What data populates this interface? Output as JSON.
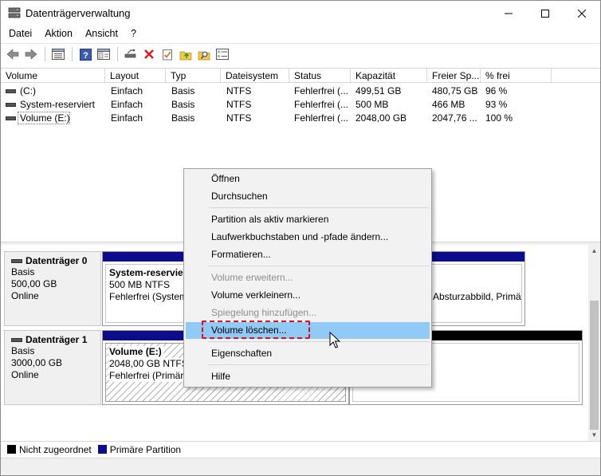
{
  "window": {
    "title": "Datenträgerverwaltung",
    "controls": {
      "minimize": "minimize",
      "maximize": "maximize",
      "close": "close"
    }
  },
  "menubar": [
    "Datei",
    "Aktion",
    "Ansicht",
    "?"
  ],
  "toolbar": [
    "back-arrow-icon",
    "forward-arrow-icon",
    "properties-list-icon",
    "help-icon",
    "console-icon",
    "connect-disk-icon",
    "delete-icon",
    "checklist-icon",
    "folder-up-icon",
    "search-folder-icon",
    "view-icon"
  ],
  "list": {
    "columns": [
      "Volume",
      "Layout",
      "Typ",
      "Dateisystem",
      "Status",
      "Kapazität",
      "Freier Sp...",
      "% frei"
    ],
    "rows": [
      {
        "volume": "(C:)",
        "layout": "Einfach",
        "typ": "Basis",
        "fs": "NTFS",
        "status": "Fehlerfrei (...",
        "capacity": "499,51 GB",
        "free": "480,75 GB",
        "pct": "96 %"
      },
      {
        "volume": "System-reserviert",
        "layout": "Einfach",
        "typ": "Basis",
        "fs": "NTFS",
        "status": "Fehlerfrei (...",
        "capacity": "500 MB",
        "free": "466 MB",
        "pct": "93 %"
      },
      {
        "volume": "Volume (E:)",
        "layout": "Einfach",
        "typ": "Basis",
        "fs": "NTFS",
        "status": "Fehlerfrei (...",
        "capacity": "2048,00 GB",
        "free": "2047,76 ...",
        "pct": "100 %"
      }
    ]
  },
  "disks": [
    {
      "name": "Datenträger 0",
      "type": "Basis",
      "size": "500,00 GB",
      "state": "Online",
      "partition_a": {
        "title": "System-reservie",
        "size": "500 MB NTFS",
        "status": "Fehlerfrei (System"
      },
      "partition_b_status": "Absturzabbild, Primä"
    },
    {
      "name": "Datenträger 1",
      "type": "Basis",
      "size": "3000,00 GB",
      "state": "Online",
      "partition_a": {
        "title": "Volume  (E:)",
        "size": "2048,00 GB NTFS",
        "status": "Fehlerfrei (Primäre"
      }
    }
  ],
  "legend": [
    {
      "label": "Nicht zugeordnet",
      "color": "#000000"
    },
    {
      "label": "Primäre Partition",
      "color": "#0d0d8c"
    }
  ],
  "context_menu": {
    "items": [
      {
        "label": "Öffnen",
        "enabled": true
      },
      {
        "label": "Durchsuchen",
        "enabled": true
      },
      {
        "label": "Partition als aktiv markieren",
        "enabled": true
      },
      {
        "label": "Laufwerkbuchstaben und -pfade ändern...",
        "enabled": true
      },
      {
        "label": "Formatieren...",
        "enabled": true
      },
      {
        "label": "Volume erweitern...",
        "enabled": false
      },
      {
        "label": "Volume verkleinern...",
        "enabled": true
      },
      {
        "label": "Spiegelung hinzufügen...",
        "enabled": false
      },
      {
        "label": "Volume löschen...",
        "enabled": true,
        "hovered": true
      },
      {
        "label": "Eigenschaften",
        "enabled": true
      },
      {
        "label": "Hilfe",
        "enabled": true
      }
    ]
  },
  "colors": {
    "primary_partition_bar": "#0d0d8c",
    "unallocated_bar": "#000000",
    "menu_hover": "#91c9f7",
    "highlight": "#d9141e"
  }
}
